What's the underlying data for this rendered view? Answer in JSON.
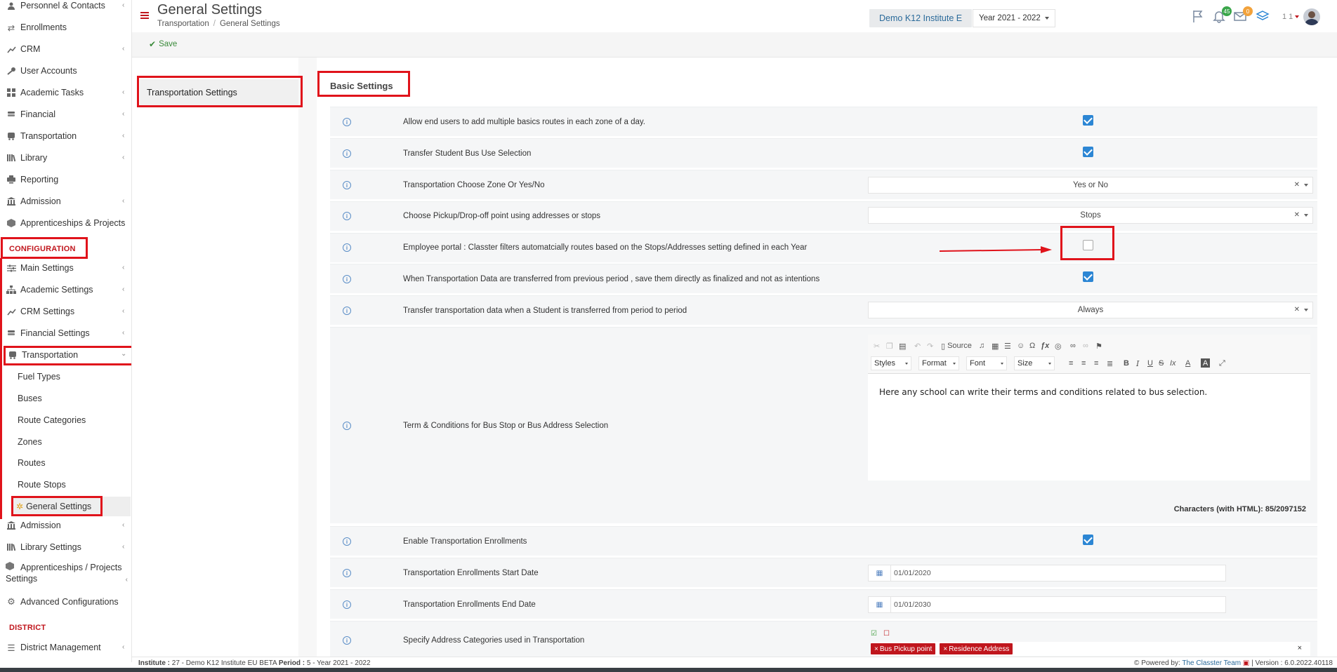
{
  "sidebar": {
    "items": [
      {
        "label": "Personnel & Contacts",
        "icon": "person-icon",
        "chevron": true
      },
      {
        "label": "Enrollments",
        "icon": "arrows-icon",
        "chevron": false
      },
      {
        "label": "CRM",
        "icon": "trend-icon",
        "chevron": true
      },
      {
        "label": "User Accounts",
        "icon": "key-icon",
        "chevron": false
      },
      {
        "label": "Academic Tasks",
        "icon": "grid-icon",
        "chevron": true
      },
      {
        "label": "Financial",
        "icon": "coins-icon",
        "chevron": true
      },
      {
        "label": "Transportation",
        "icon": "bus-icon",
        "chevron": true
      },
      {
        "label": "Library",
        "icon": "books-icon",
        "chevron": true
      },
      {
        "label": "Reporting",
        "icon": "printer-icon",
        "chevron": false
      },
      {
        "label": "Admission",
        "icon": "bank-icon",
        "chevron": true
      },
      {
        "label": "Apprenticeships & Projects",
        "icon": "cube-icon",
        "chevron": true
      }
    ],
    "configuration_label": "CONFIGURATION",
    "config_items": [
      {
        "label": "Main Settings",
        "icon": "sliders-icon",
        "chevron": true
      },
      {
        "label": "Academic Settings",
        "icon": "org-icon",
        "chevron": true
      },
      {
        "label": "CRM Settings",
        "icon": "trend-icon",
        "chevron": true
      },
      {
        "label": "Financial Settings",
        "icon": "coins-icon",
        "chevron": true
      },
      {
        "label": "Transportation",
        "icon": "bus-icon",
        "chevron": true
      }
    ],
    "transport_sub": [
      "Fuel Types",
      "Buses",
      "Route Categories",
      "Zones",
      "Routes",
      "Route Stops"
    ],
    "active_sub": "General Settings",
    "config_items_after": [
      {
        "label": "Admission",
        "icon": "bank-icon",
        "chevron": true
      },
      {
        "label": "Library Settings",
        "icon": "books-icon",
        "chevron": true
      }
    ],
    "apprentice_settings_line1": "Apprenticeships / Projects",
    "apprentice_settings_line2": "Settings",
    "advanced_label": "Advanced Configurations",
    "district_label": "DISTRICT",
    "district_item": "District Management"
  },
  "header": {
    "title": "General Settings",
    "breadcrumb": [
      "Transportation",
      "General Settings"
    ],
    "institute": "Demo K12 Institute E",
    "year": "Year 2021 - 2022",
    "notif_count": "45",
    "mail_count": "0",
    "user_num": "1 1"
  },
  "toolbar": {
    "save_label": "Save"
  },
  "left_tab": "Transportation Settings",
  "section_title": "Basic Settings",
  "rows": {
    "r1": "Allow end users to add multiple basics routes in each zone of a day.",
    "r2": "Transfer Student Bus Use Selection",
    "r3": "Transportation Choose Zone Or Yes/No",
    "r3_value": "Yes or No",
    "r4": "Choose Pickup/Drop-off point using addresses or stops",
    "r4_value": "Stops",
    "r5": "Employee portal : Classter filters automatcially routes based on the Stops/Addresses setting defined in each Year",
    "r6": "When Transportation Data are transferred from previous period , save them directly as finalized and not as intentions",
    "r7": "Transfer transportation data when a Student is transferred from period to period",
    "r7_value": "Always",
    "r8": "Term & Conditions for Bus Stop or Bus Address Selection",
    "r9": "Enable Transportation Enrollments",
    "r10": "Transportation Enrollments Start Date",
    "r10_value": "01/01/2020",
    "r11": "Transportation Enrollments End Date",
    "r11_value": "01/01/2030",
    "r12": "Specify Address Categories used in Transportation",
    "r12_tags": [
      "Bus Pickup point",
      "Residence Address"
    ]
  },
  "editor": {
    "source_label": "Source",
    "styles": "Styles",
    "format": "Format",
    "font": "Font",
    "size": "Size",
    "content": "Here any school can write their terms and conditions related to bus selection.",
    "char_count": "Characters (with HTML): 85/2097152"
  },
  "footer": {
    "institute_label": "Institute :",
    "institute_value": "27 - Demo K12 Institute EU BETA",
    "period_label": "Period :",
    "period_value": "5 - Year 2021 - 2022",
    "powered_label": "Powered by:",
    "powered_link": "The Classter Team",
    "version": "| Version : 6.0.2022.40118"
  },
  "colors": {
    "accent_red": "#c0161d",
    "annotation_red": "#e0131b",
    "checkbox_blue": "#2c86d4"
  }
}
